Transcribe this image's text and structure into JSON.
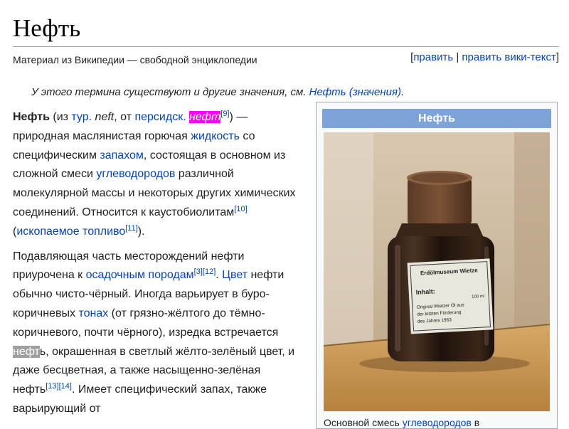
{
  "page": {
    "title": "Нефть",
    "tagline": "Материал из Википедии — свободной энциклопедии"
  },
  "edit_links": {
    "open": "[",
    "edit": "править",
    "separator": " | ",
    "edit_source": "править вики-текст",
    "close": "]"
  },
  "hatnote": {
    "prefix": "У этого термина существуют и другие значения, см. ",
    "link": "Нефть (значения)",
    "suffix": "."
  },
  "paragraph1": {
    "bold_term": "Нефть",
    "t1": " (из ",
    "link_tur": "тур.",
    "t2": " ",
    "word_neft": "neft",
    "t3": ", от ",
    "link_pers": "персидск.",
    "t4": " ",
    "word_naft": "нефт",
    "ref9": "[9]",
    "t5": ") — природная маслянистая горючая ",
    "link_liquid": "жидкость",
    "t6": " со специфическим ",
    "link_smell": "запахом",
    "t7": ", состоящая в основном из сложной смеси ",
    "link_hc": "углеводородов",
    "t8": " различной молекулярной массы и некоторых других химических соединений. Относится к каустобиолитам",
    "ref10": "[10]",
    "t9": " (",
    "link_fossil": "ископаемое топливо",
    "ref11": "[11]",
    "t10": ")."
  },
  "paragraph2": {
    "t1": "Подавляющая часть месторождений нефти приурочена к ",
    "link_sed": "осадочным породам",
    "ref3": "[3]",
    "ref12": "[12]",
    "t2": ". ",
    "link_color": "Цвет",
    "t3": " нефти обычно чисто-чёрный. Иногда варьирует в буро-коричневых ",
    "link_tones": "тонах",
    "t4": " (от грязно-жёлтого до тёмно-коричневого, почти чёрного), изредка встречается ",
    "highlight": "нефт",
    "t5": "ь, окрашенная в светлый жёлто-зелёный цвет, и даже бесцветная, а также насыщенно-зелёная нефть",
    "ref13": "[13]",
    "ref14": "[14]",
    "t6": ". Имеет специфический запах, также варьирующий от"
  },
  "infobox": {
    "title": "Нефть",
    "label": {
      "line1": "Erdölmuseum Wietze",
      "line2": "Inhalt:",
      "line3": "100 ml",
      "line4": "Original Wietzer Öl aus",
      "line5": "der letzten Förderung",
      "line6": "des Jahres 1963"
    },
    "caption_prefix": "Основной ",
    "caption_mid": " смесь ",
    "caption_link": "углеводородов",
    "caption_suffix": " в"
  },
  "colors": {
    "link": "#0645ad",
    "infobox_header": "#7ea3d8",
    "highlight_magenta": "#ff00ff",
    "highlight_gray": "#9f9f9f"
  },
  "icons": {
    "photo": "oil-bottle-photo"
  }
}
